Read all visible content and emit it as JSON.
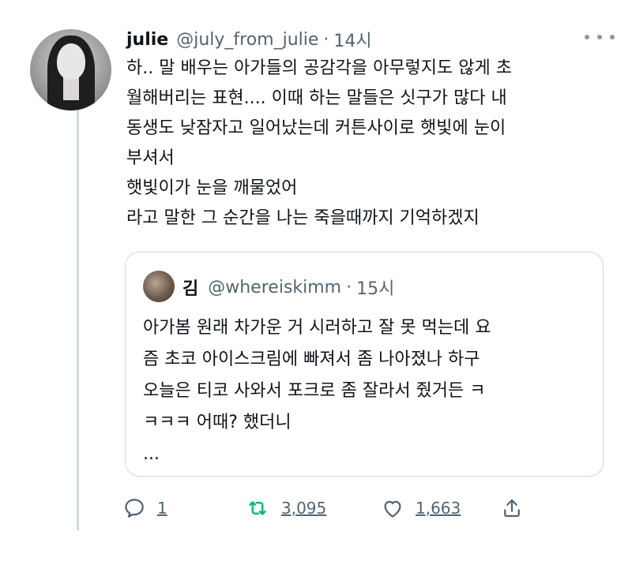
{
  "tweet": {
    "author_name": "julie",
    "handle": "@july_from_julie",
    "separator": "·",
    "time": "14시",
    "lines": [
      "하.. 말 배우는 아가들의 공감각을 아무렇지도 않게 초",
      "월해버리는 표현.... 이때 하는 말들은 싯구가 많다 내",
      "동생도 낮잠자고 일어났는데 커튼사이로 햇빛에 눈이",
      "부셔서",
      "햇빛이가 눈을 깨물었어",
      "라고 말한 그 순간을 나는 죽을때까지 기억하겠지"
    ]
  },
  "quote": {
    "author_name": "김",
    "handle": "@whereiskimm",
    "separator": "·",
    "time": "15시",
    "lines": [
      "아가봄 원래 차가운 거 시러하고 잘 못 먹는데 요",
      "즘 초코 아이스크림에 빠져서 좀 나아졌나 하구",
      "오늘은 티코 사와서 포크로 좀 잘라서 줬거든 ㅋ",
      "ㅋㅋㅋ 어때? 했더니",
      "..."
    ]
  },
  "actions": {
    "reply_count": "1",
    "retweet_count": "3,095",
    "like_count": "1,663"
  },
  "icons": {
    "reply": "reply-icon",
    "retweet": "retweet-icon",
    "like": "heart-icon",
    "share": "share-icon",
    "more": "more-icon"
  },
  "colors": {
    "text": "#0f1419",
    "muted": "#536471",
    "retweet_green": "#00ba7c",
    "border": "#cfd9de"
  }
}
